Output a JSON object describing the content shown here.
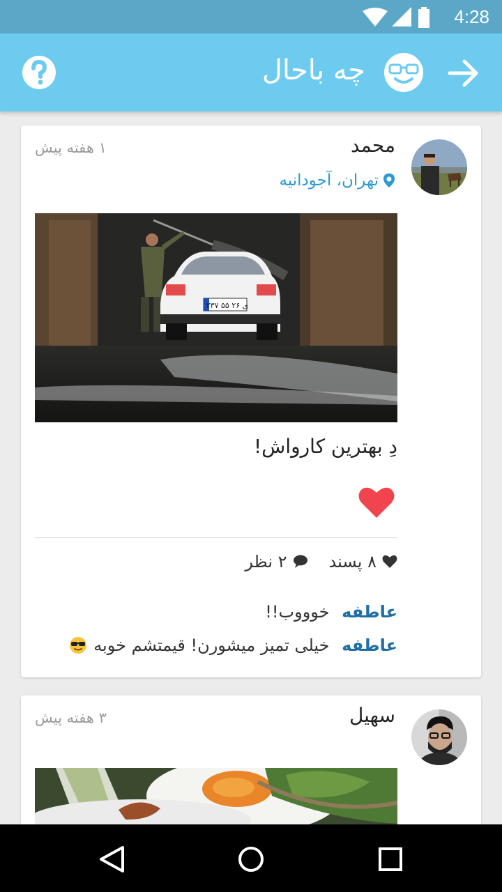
{
  "status_bar": {
    "time": "4:28",
    "icons": [
      "wifi-icon",
      "signal-icon",
      "battery-icon"
    ]
  },
  "app_bar": {
    "title": "چه باحال",
    "icons": [
      "help-icon",
      "smiley-icon",
      "arrow-forward-icon"
    ],
    "color": "#6ccbef"
  },
  "posts": [
    {
      "author": "محمد",
      "time_ago": "۱ هفته پیش",
      "location": "تهران، آجودانیه",
      "caption": "دِ بهترین کارواش!",
      "liked": true,
      "stats": {
        "likes": "۸ پسند",
        "comments": "۲ نظر"
      },
      "comments": [
        {
          "author": "عاطفه",
          "text": "خوووب!!"
        },
        {
          "author": "عاطفه",
          "text": "خیلی تمیز میشورن! قیمتشم خوبه"
        }
      ],
      "plate": "۲۳۷ ی ۲۶ ۵۵"
    },
    {
      "author": "سهیل",
      "time_ago": "۳ هفته پیش"
    }
  ],
  "nav_bar": {
    "icons": [
      "back-nav-icon",
      "home-nav-icon",
      "recents-nav-icon"
    ]
  },
  "colors": {
    "accent": "#6ccbef",
    "status_bar": "#5aa7c7",
    "link": "#2d9ad3",
    "comment_author": "#1d6fa5",
    "heart": "#f2444f"
  }
}
